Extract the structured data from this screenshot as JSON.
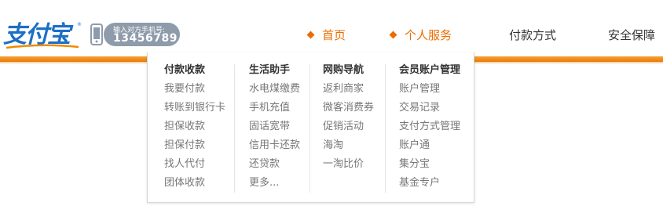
{
  "logo": {
    "text": "支付宝",
    "tm": "®"
  },
  "phone_badge": {
    "hint": "输入对方手机号:",
    "number": "13456789"
  },
  "nav": [
    {
      "label": "首页",
      "active": true
    },
    {
      "label": "个人服务",
      "active": true
    },
    {
      "label": "付款方式",
      "active": false
    },
    {
      "label": "安全保障",
      "active": false
    }
  ],
  "menu": {
    "columns": [
      {
        "heading": "付款收款",
        "items": [
          "我要付款",
          "转账到银行卡",
          "担保收款",
          "担保付款",
          "找人代付",
          "团体收款"
        ]
      },
      {
        "heading": "生活助手",
        "items": [
          "水电煤缴费",
          "手机充值",
          "固话宽带",
          "信用卡还款",
          "还贷款",
          "更多..."
        ]
      },
      {
        "heading": "网购导航",
        "items": [
          "返利商家",
          "微客消费券",
          "促销活动",
          "海淘",
          "一淘比价"
        ]
      },
      {
        "heading": "会员账户管理",
        "items": [
          "账户管理",
          "交易记录",
          "支付方式管理",
          "账户通",
          "集分宝",
          "基金专户"
        ]
      }
    ]
  },
  "colors": {
    "accent": "#ec6c00",
    "brand_blue": "#1d6fc6",
    "badge_gray": "#8e9bab"
  }
}
